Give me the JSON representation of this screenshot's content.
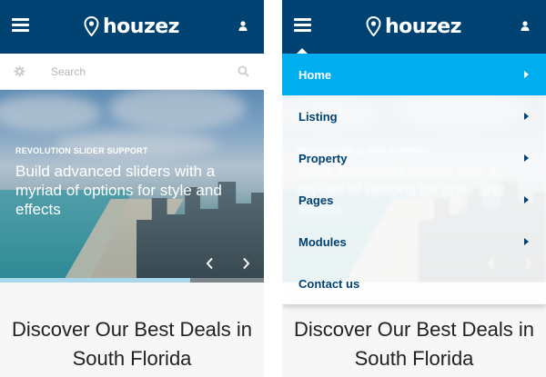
{
  "colors": {
    "header_bg": "#004272",
    "menu_active_bg": "#00aeef",
    "menu_text": "#004272",
    "heading_text": "#222222"
  },
  "header": {
    "logo_text": "houzez",
    "icons": [
      "menu-icon",
      "location-pin-icon",
      "user-icon"
    ]
  },
  "search": {
    "placeholder": "Search",
    "icons": [
      "gear-icon",
      "search-icon"
    ]
  },
  "slider": {
    "kicker": "REVOLUTION SLIDER SUPPORT",
    "heading": "Build advanced sliders with a myriad of options for style and effects",
    "progress": 0.72,
    "controls": [
      "chevron-left-icon",
      "chevron-right-icon"
    ]
  },
  "section": {
    "title": "Discover Our Best Deals in South Florida"
  },
  "menu": {
    "items": [
      {
        "label": "Home",
        "active": true,
        "has_submenu": true
      },
      {
        "label": "Listing",
        "active": false,
        "has_submenu": true
      },
      {
        "label": "Property",
        "active": false,
        "has_submenu": true
      },
      {
        "label": "Pages",
        "active": false,
        "has_submenu": true
      },
      {
        "label": "Modules",
        "active": false,
        "has_submenu": true
      },
      {
        "label": "Contact us",
        "active": false,
        "has_submenu": false
      }
    ]
  }
}
